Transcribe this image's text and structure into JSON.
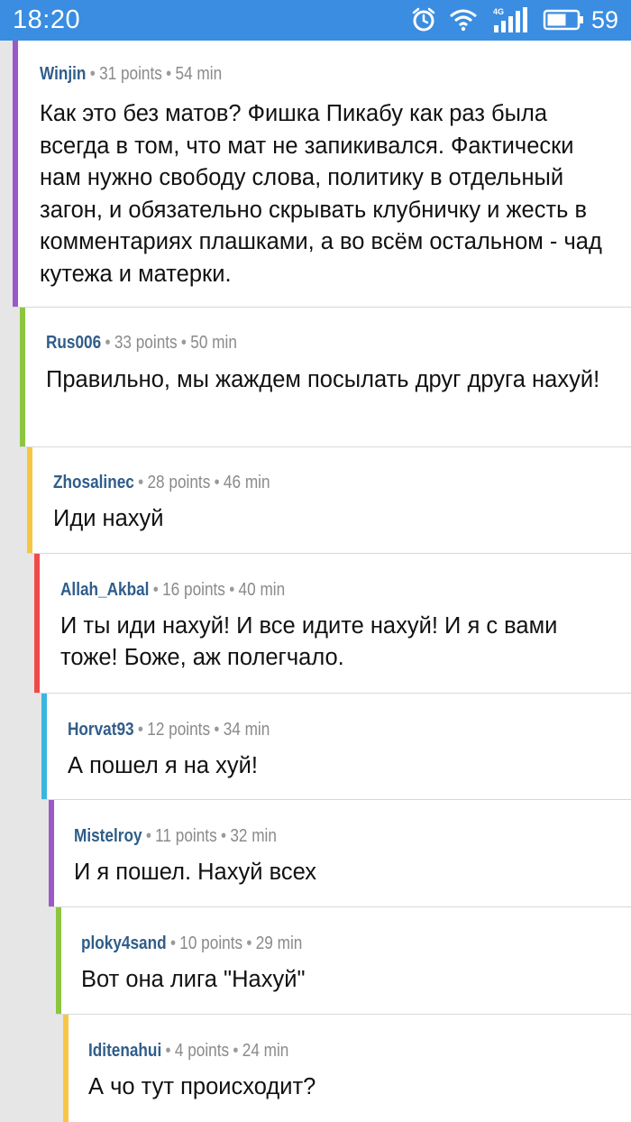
{
  "status_bar": {
    "time": "18:20",
    "network_label": "4G",
    "battery_level": "59",
    "color": "#3a8de0"
  },
  "comments": [
    {
      "author": "Winjin",
      "points": "31 points",
      "age": "54 min",
      "text": "Как это без матов? Фишка Пикабу как раз была всегда в том, что мат не запикивался. Фактически нам нужно свободу слова, политику в отдельный загон, и обязательно скрывать клубничку и жесть в комментариях плашками, а во всём остальном - чад кутежа и матерки.",
      "color": "#9b59c7"
    },
    {
      "author": "Rus006",
      "points": "33 points",
      "age": "50 min",
      "text": "Правильно, мы жаждем посылать друг друга нахуй!",
      "color": "#8cc63f"
    },
    {
      "author": "Zhosalinec",
      "points": "28 points",
      "age": "46 min",
      "text": "Иди нахуй",
      "color": "#f7c744"
    },
    {
      "author": "Allah_Akbal",
      "points": "16 points",
      "age": "40 min",
      "text": "И ты иди нахуй! И все идите нахуй! И я с вами тоже! Боже, аж полегчало.",
      "color": "#f04a4a"
    },
    {
      "author": "Horvat93",
      "points": "12 points",
      "age": "34 min",
      "text": "А пошел я на хуй!",
      "color": "#3bb5e0"
    },
    {
      "author": "Mistelroy",
      "points": "11 points",
      "age": "32 min",
      "text": "И я пошел. Нахуй всех",
      "color": "#9b59c7"
    },
    {
      "author": "ploky4sand",
      "points": "10 points",
      "age": "29 min",
      "text": "Вот она лига \"Нахуй\"",
      "color": "#8cc63f"
    },
    {
      "author": "Iditenahui",
      "points": "4 points",
      "age": "24 min",
      "text": "А чо тут происходит?",
      "color": "#f7c744"
    }
  ]
}
